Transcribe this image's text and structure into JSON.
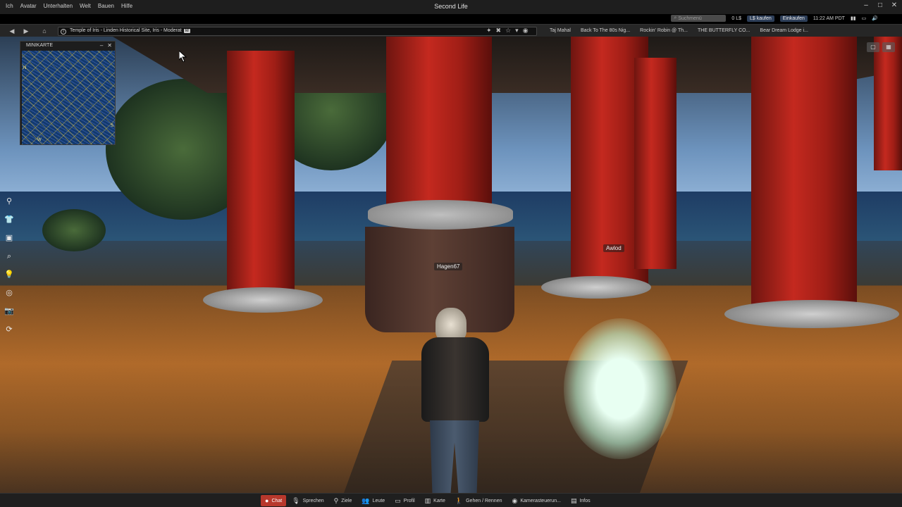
{
  "window": {
    "title": "Second Life"
  },
  "menu": [
    "Ich",
    "Avatar",
    "Unterhalten",
    "Welt",
    "Bauen",
    "Hilfe"
  ],
  "window_controls": [
    "–",
    "□",
    "✕"
  ],
  "status": {
    "search_placeholder": "Suchmenü",
    "balance": "0 L$",
    "buy_label": "L$ kaufen",
    "shop_label": "Einkaufen",
    "time": "11:22 AM PDT"
  },
  "navbar": {
    "location": "Temple of Iris - Linden Historical Site, Iris - Moderat",
    "maturity": "M"
  },
  "favorites": [
    "Taj Mahal",
    "Back To The 80s Nig...",
    "Rockin' Robin @ Th...",
    "THE BUTTERFLY CO...",
    "Bear Dream Lodge i..."
  ],
  "minimap": {
    "title": "MINIKARTE",
    "compass": {
      "n": "N",
      "s": "S",
      "w": "W"
    }
  },
  "nametags": {
    "hagen": "Hagen67",
    "awlod": "Awlod"
  },
  "bottombar": [
    {
      "label": "Chat",
      "icon": "chat-icon",
      "active": true
    },
    {
      "label": "Sprechen",
      "icon": "mic-icon",
      "active": false
    },
    {
      "label": "Ziele",
      "icon": "pin-icon",
      "active": false
    },
    {
      "label": "Leute",
      "icon": "people-icon",
      "active": false
    },
    {
      "label": "Profil",
      "icon": "profile-icon",
      "active": false
    },
    {
      "label": "Karte",
      "icon": "map-icon",
      "active": false
    },
    {
      "label": "Gehen / Rennen",
      "icon": "walk-icon",
      "active": false
    },
    {
      "label": "Kamerasteuerun...",
      "icon": "camera-icon",
      "active": false
    },
    {
      "label": "Infos",
      "icon": "info-icon",
      "active": false
    }
  ],
  "colors": {
    "active_button": "#b8382c",
    "pillar_red": "#c4291f"
  }
}
